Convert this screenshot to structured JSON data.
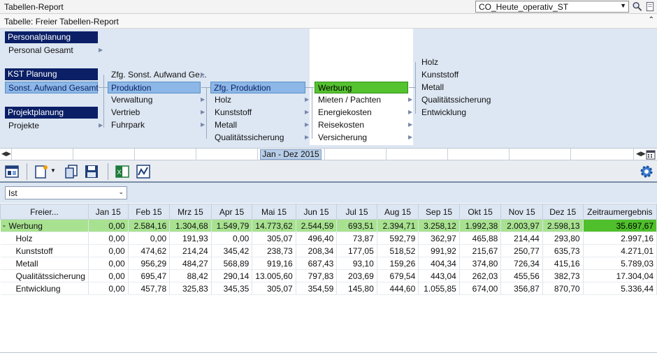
{
  "window": {
    "title": "Tabellen-Report",
    "profile_value": "CO_Heute_operativ_ST"
  },
  "subheader": {
    "text": "Tabelle: Freier Tabellen-Report"
  },
  "tree": {
    "col1": {
      "groups": [
        {
          "header": "Personalplanung",
          "items": [
            "Personal Gesamt"
          ]
        },
        {
          "header": "KST Planung",
          "items": [
            "Sonst. Aufwand Gesamt"
          ]
        },
        {
          "header": "Projektplanung",
          "items": [
            "Projekte"
          ]
        }
      ]
    },
    "col2": [
      "Zfg. Sonst. Aufwand Ge...",
      "Produktion",
      "Verwaltung",
      "Vertrieb",
      "Fuhrpark"
    ],
    "col3": [
      "Zfg. Produktion",
      "Holz",
      "Kunststoff",
      "Metall",
      "Qualitätssicherung"
    ],
    "col4": [
      "Werbung",
      "Mieten / Pachten",
      "Energiekosten",
      "Reisekosten",
      "Versicherung"
    ],
    "col5": [
      "Holz",
      "Kunststoff",
      "Metall",
      "Qualitätssicherung",
      "Entwicklung"
    ]
  },
  "timeline": {
    "range_label": "Jan - Dez 2015"
  },
  "filter": {
    "scenario": "Ist"
  },
  "table": {
    "columns": [
      "Freier...",
      "Jan 15",
      "Feb 15",
      "Mrz 15",
      "Apr 15",
      "Mai 15",
      "Jun 15",
      "Jul 15",
      "Aug 15",
      "Sep 15",
      "Okt 15",
      "Nov 15",
      "Dez 15",
      "Zeitraumergebnis"
    ],
    "group": {
      "name": "Werbung",
      "values": [
        "0,00",
        "2.584,16",
        "1.304,68",
        "1.549,79",
        "14.773,62",
        "2.544,59",
        "693,51",
        "2.394,71",
        "3.258,12",
        "1.992,38",
        "2.003,97",
        "2.598,13"
      ],
      "total": "35.697,67"
    },
    "rows": [
      {
        "name": "Holz",
        "values": [
          "0,00",
          "0,00",
          "191,93",
          "0,00",
          "305,07",
          "496,40",
          "73,87",
          "592,79",
          "362,97",
          "465,88",
          "214,44",
          "293,80"
        ],
        "total": "2.997,16"
      },
      {
        "name": "Kunststoff",
        "values": [
          "0,00",
          "474,62",
          "214,24",
          "345,42",
          "238,73",
          "208,34",
          "177,05",
          "518,52",
          "991,92",
          "215,67",
          "250,77",
          "635,73"
        ],
        "total": "4.271,01"
      },
      {
        "name": "Metall",
        "values": [
          "0,00",
          "956,29",
          "484,27",
          "568,89",
          "919,16",
          "687,43",
          "93,10",
          "159,26",
          "404,34",
          "374,80",
          "726,34",
          "415,16"
        ],
        "total": "5.789,03"
      },
      {
        "name": "Qualitätssicherung",
        "values": [
          "0,00",
          "695,47",
          "88,42",
          "290,14",
          "13.005,60",
          "797,83",
          "203,69",
          "679,54",
          "443,04",
          "262,03",
          "455,56",
          "382,73"
        ],
        "total": "17.304,04"
      },
      {
        "name": "Entwicklung",
        "values": [
          "0,00",
          "457,78",
          "325,83",
          "345,35",
          "305,07",
          "354,59",
          "145,80",
          "444,60",
          "1.055,85",
          "674,00",
          "356,87",
          "870,70"
        ],
        "total": "5.336,44"
      }
    ]
  }
}
